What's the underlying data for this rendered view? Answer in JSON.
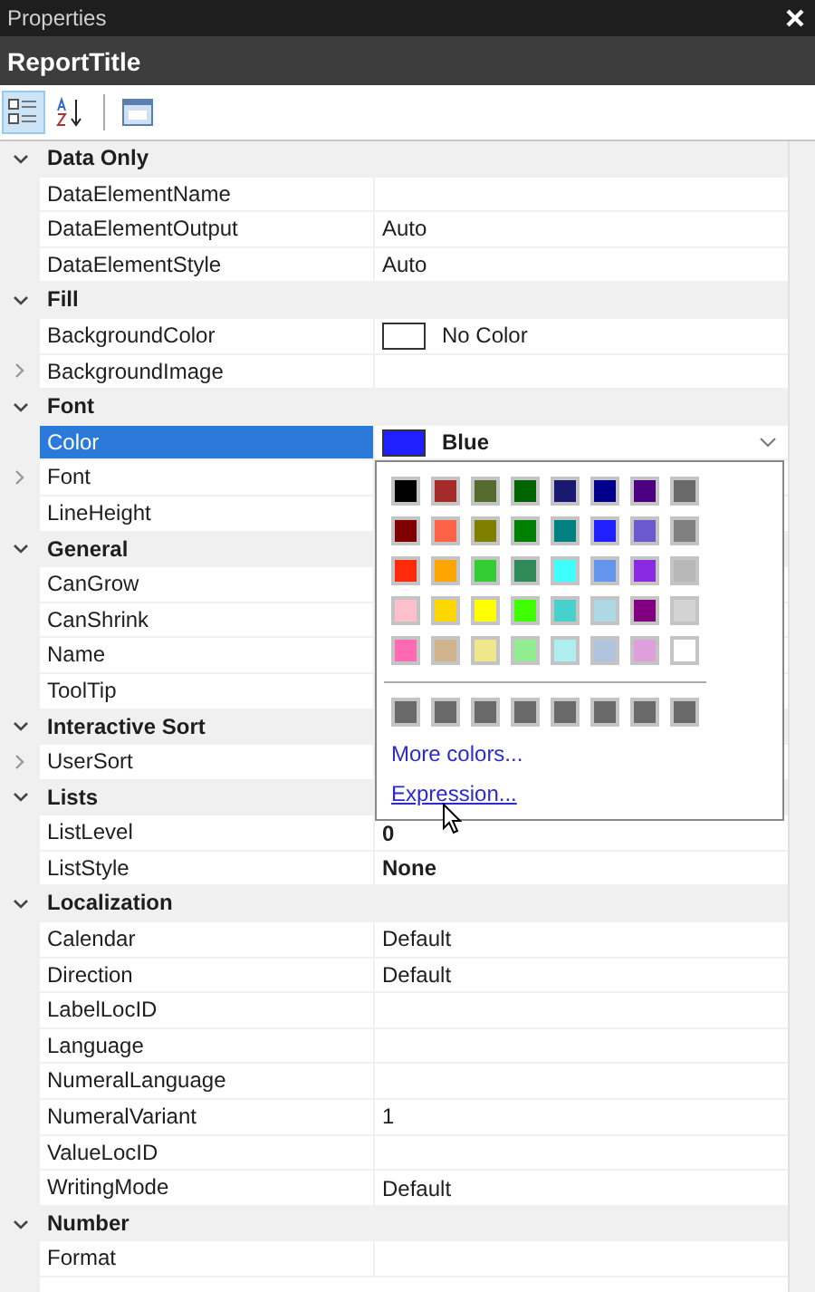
{
  "window": {
    "title": "Properties"
  },
  "object_name": "ReportTitle",
  "toolbar": [
    {
      "kind": "categorized",
      "selected": true
    },
    {
      "kind": "alphabetical",
      "selected": false
    },
    {
      "kind": "pages",
      "selected": false
    }
  ],
  "categories": [
    {
      "name": "Data Only",
      "expanded": true,
      "children": [
        {
          "name": "DataElementName",
          "selected": false
        },
        {
          "name": "DataElementOutput",
          "value": "Auto",
          "selected": false
        },
        {
          "name": "DataElementStyle",
          "value": "Auto",
          "selected": false
        }
      ]
    },
    {
      "name": "Fill",
      "expanded": true,
      "children": [
        {
          "name": "BackgroundColor",
          "value": "No Color",
          "color": "#ffffff",
          "selected": false
        },
        {
          "name": "BackgroundImage",
          "expanded": false,
          "selected": false
        }
      ]
    },
    {
      "name": "Font",
      "expanded": true,
      "children": [
        {
          "name": "Color",
          "value": "Blue",
          "color": "#1f1fff",
          "modified": true,
          "selected": true,
          "dropdown": {
            "open": true,
            "colors": [
              {
                "color": "#000000"
              },
              {
                "color": "#a52a2a"
              },
              {
                "color": "#556b2f"
              },
              {
                "color": "#006400"
              },
              {
                "color": "#191970"
              },
              {
                "color": "#00008b"
              },
              {
                "color": "#4b0082"
              },
              {
                "color": "#696969"
              },
              {
                "color": "#800000"
              },
              {
                "color": "#ff6347"
              },
              {
                "color": "#808000"
              },
              {
                "color": "#008000"
              },
              {
                "color": "#008080"
              },
              {
                "color": "#1f1fff"
              },
              {
                "color": "#6a5acd"
              },
              {
                "color": "#808080"
              },
              {
                "color": "#ff2a0a"
              },
              {
                "color": "#ffa500"
              },
              {
                "color": "#32cd32"
              },
              {
                "color": "#2e8b57"
              },
              {
                "color": "#40ffff"
              },
              {
                "color": "#6495ed"
              },
              {
                "color": "#8a2be2"
              },
              {
                "color": "#b8b8b8"
              },
              {
                "color": "#ffc0cb"
              },
              {
                "color": "#ffd700"
              },
              {
                "color": "#ffff00"
              },
              {
                "color": "#40ff00"
              },
              {
                "color": "#48d1cc"
              },
              {
                "color": "#add8e6"
              },
              {
                "color": "#800080"
              },
              {
                "color": "#d3d3d3"
              },
              {
                "color": "#ff69b4"
              },
              {
                "color": "#d2b48c"
              },
              {
                "color": "#f0e68c"
              },
              {
                "color": "#90ee90"
              },
              {
                "color": "#afeeee"
              },
              {
                "color": "#b0c4de"
              },
              {
                "color": "#dda0dd"
              },
              {
                "color": "#ffffff"
              }
            ],
            "custom_colors": [
              {
                "color": "#696969"
              },
              {
                "color": "#696969"
              },
              {
                "color": "#696969"
              },
              {
                "color": "#696969"
              },
              {
                "color": "#696969"
              },
              {
                "color": "#696969"
              },
              {
                "color": "#696969"
              },
              {
                "color": "#696969"
              }
            ],
            "links": [
              "More colors...",
              "Expression..."
            ]
          }
        },
        {
          "name": "Font",
          "expanded": false,
          "selected": false
        },
        {
          "name": "LineHeight",
          "selected": false
        }
      ]
    },
    {
      "name": "General",
      "expanded": true,
      "children": [
        {
          "name": "CanGrow",
          "selected": false
        },
        {
          "name": "CanShrink",
          "selected": false
        },
        {
          "name": "Name",
          "selected": false
        },
        {
          "name": "ToolTip",
          "selected": false
        }
      ]
    },
    {
      "name": "Interactive Sort",
      "expanded": true,
      "children": [
        {
          "name": "UserSort",
          "expanded": false,
          "selected": false
        }
      ]
    },
    {
      "name": "Lists",
      "expanded": true,
      "children": [
        {
          "name": "ListLevel",
          "value": "0",
          "modified": true,
          "selected": false
        },
        {
          "name": "ListStyle",
          "value": "None",
          "modified": true,
          "selected": false
        }
      ]
    },
    {
      "name": "Localization",
      "expanded": true,
      "children": [
        {
          "name": "Calendar",
          "value": "Default",
          "selected": false
        },
        {
          "name": "Direction",
          "value": "Default",
          "selected": false
        },
        {
          "name": "LabelLocID",
          "selected": false
        },
        {
          "name": "Language",
          "selected": false
        },
        {
          "name": "NumeralLanguage",
          "selected": false
        },
        {
          "name": "NumeralVariant",
          "value": "1",
          "selected": false
        },
        {
          "name": "ValueLocID",
          "selected": false
        },
        {
          "name": "WritingMode",
          "value": "Default",
          "selected": false
        }
      ]
    },
    {
      "name": "Number",
      "expanded": true,
      "children": [
        {
          "name": "Format",
          "selected": false
        }
      ]
    }
  ]
}
